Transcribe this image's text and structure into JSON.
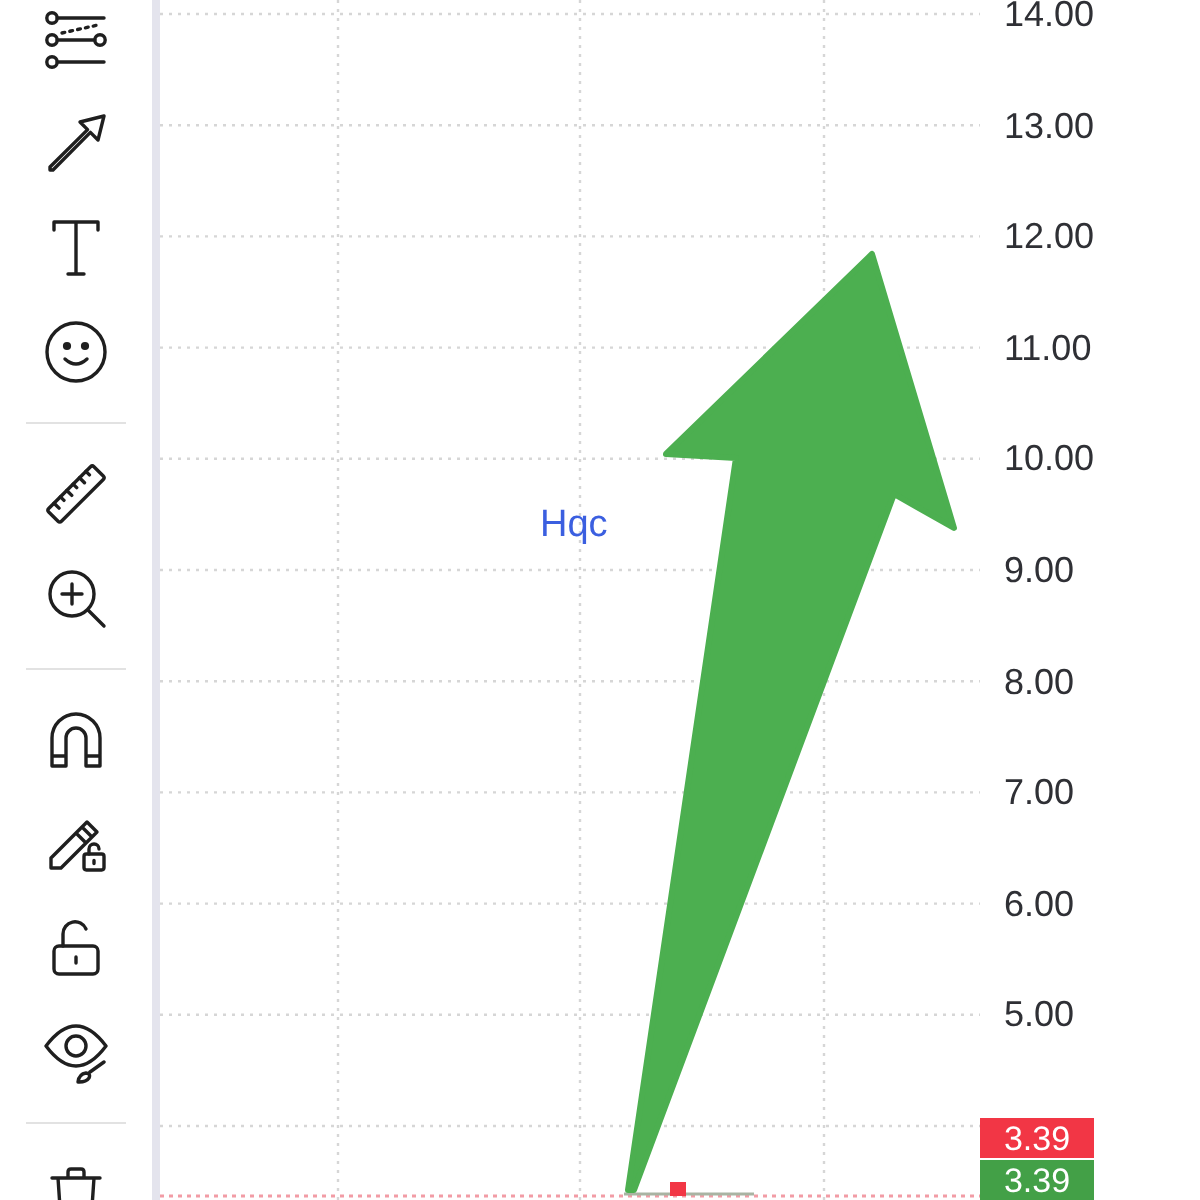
{
  "chart": {
    "symbol_label": "Hqc",
    "price_axis": {
      "labels": [
        "14.00",
        "13.00",
        "12.00",
        "11.00",
        "10.00",
        "9.00",
        "8.00",
        "7.00",
        "6.00",
        "5.00"
      ]
    },
    "price_badges": [
      {
        "text": "3.39",
        "color": "#f23645"
      },
      {
        "text": "3.39",
        "color": "#43a047"
      }
    ]
  }
}
